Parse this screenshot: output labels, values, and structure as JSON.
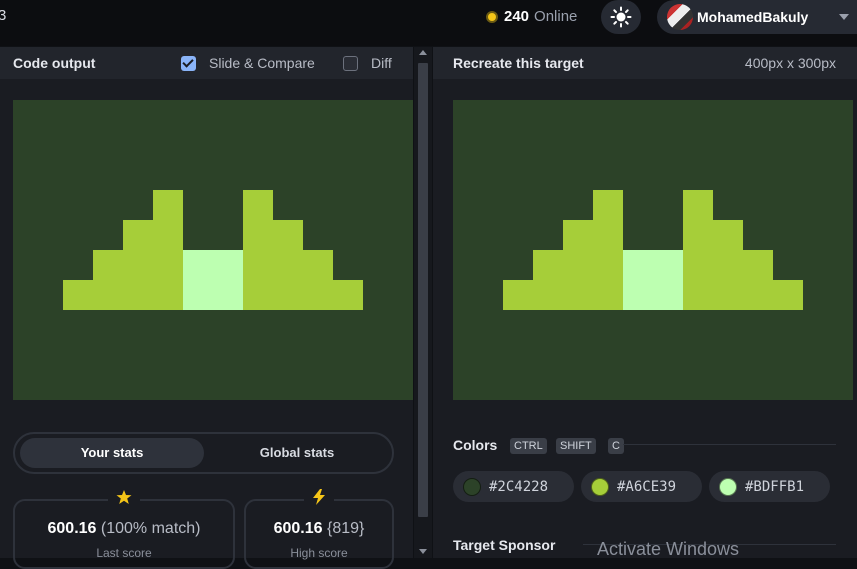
{
  "topbar": {
    "edge_glyph": "3",
    "online_count": "240",
    "online_label": "Online",
    "username": "MohamedBakuly"
  },
  "left_panel": {
    "title": "Code output",
    "slide_compare_label": "Slide & Compare",
    "slide_compare_checked": true,
    "diff_label": "Diff",
    "diff_checked": false
  },
  "right_panel": {
    "title": "Recreate this target",
    "size": "400px x 300px"
  },
  "target": {
    "background": "#2C4228",
    "shape_color": "#A6CE39",
    "center_color": "#BDFFB1"
  },
  "stats": {
    "tabs": [
      "Your stats",
      "Global stats"
    ],
    "last_score": {
      "value": "600.16",
      "detail": "(100% match)",
      "label": "Last score"
    },
    "high_score": {
      "value": "600.16",
      "detail": "{819}",
      "label": "High score"
    }
  },
  "colors": {
    "title": "Colors",
    "shortcut_keys": [
      "CTRL",
      "SHIFT",
      "C"
    ],
    "swatches": [
      {
        "hex": "#2C4228"
      },
      {
        "hex": "#A6CE39"
      },
      {
        "hex": "#BDFFB1"
      }
    ]
  },
  "sponsor": {
    "title": "Target Sponsor"
  },
  "watermark": "Activate Windows"
}
